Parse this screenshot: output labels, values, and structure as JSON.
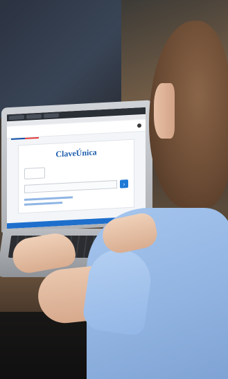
{
  "screen": {
    "login_title": "ClaveÚnica"
  },
  "colors": {
    "shirt": "#a6c6ee",
    "screen_accent": "#1e6fcc",
    "hair": "#6b4b34"
  },
  "icons": {
    "go": "arrow-right-icon"
  }
}
